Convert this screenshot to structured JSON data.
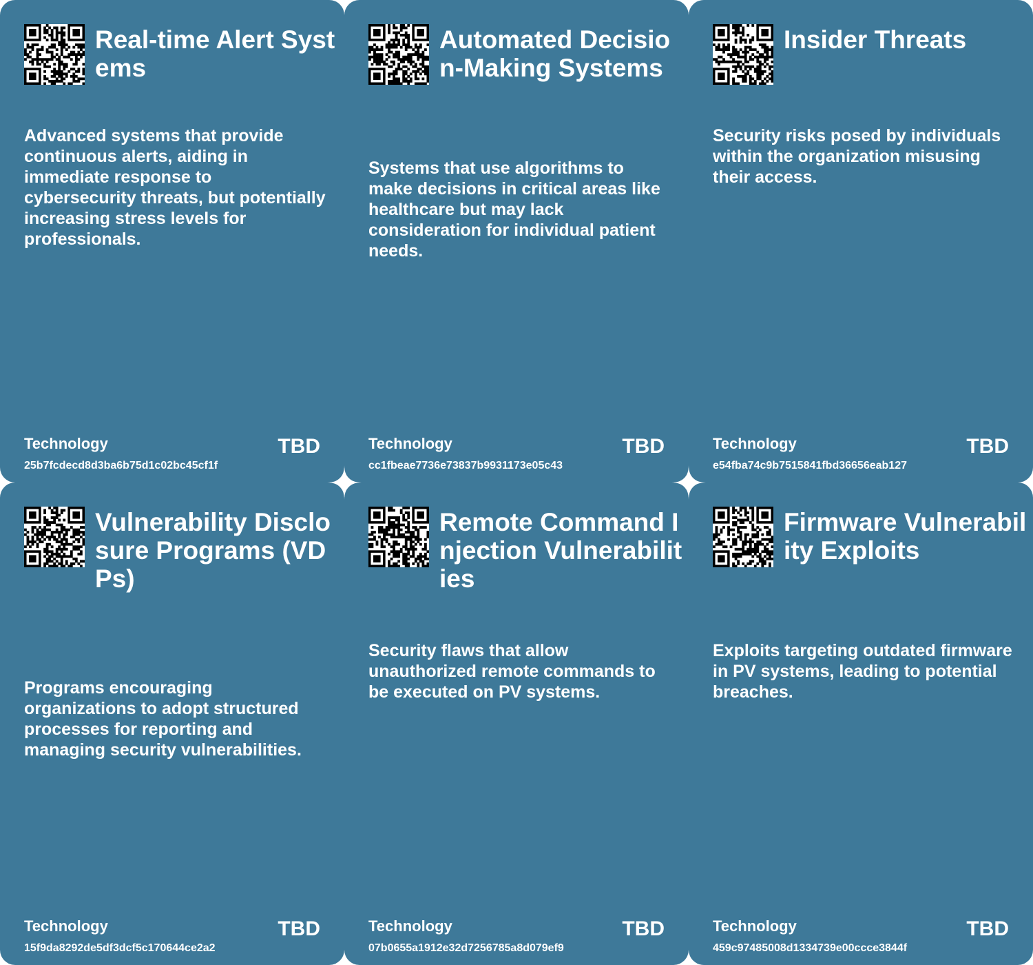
{
  "colors": {
    "card_background": "#3e7999",
    "text": "#ffffff",
    "page_background": "#ffffff"
  },
  "cards": [
    {
      "title": "Real-time Alert Systems",
      "description": "Advanced systems that provide continuous alerts, aiding in immediate response to cybersecurity threats, but potentially increasing stress levels for professionals.",
      "category": "Technology",
      "status": "TBD",
      "hash": "25b7fcdecd8d3ba6b75d1c02bc45cf1f",
      "icon": "qr-code-icon"
    },
    {
      "title": "Automated Decision-Making Systems",
      "description": "Systems that use algorithms to make decisions in critical areas like healthcare but may lack consideration for individual patient needs.",
      "category": "Technology",
      "status": "TBD",
      "hash": "cc1fbeae7736e73837b9931173e05c43",
      "icon": "qr-code-icon"
    },
    {
      "title": "Insider Threats",
      "description": "Security risks posed by individuals within the organization misusing their access.",
      "category": "Technology",
      "status": "TBD",
      "hash": "e54fba74c9b7515841fbd36656eab127",
      "icon": "qr-code-icon"
    },
    {
      "title": "Vulnerability Disclosure Programs (VDPs)",
      "description": "Programs encouraging organizations to adopt structured processes for reporting and managing security vulnerabilities.",
      "category": "Technology",
      "status": "TBD",
      "hash": "15f9da8292de5df3dcf5c170644ce2a2",
      "icon": "qr-code-icon"
    },
    {
      "title": "Remote Command Injection Vulnerabilities",
      "description": "Security flaws that allow unauthorized remote commands to be executed on PV systems.",
      "category": "Technology",
      "status": "TBD",
      "hash": "07b0655a1912e32d7256785a8d079ef9",
      "icon": "qr-code-icon"
    },
    {
      "title": "Firmware Vulnerability Exploits",
      "description": "Exploits targeting outdated firmware in PV systems, leading to potential breaches.",
      "category": "Technology",
      "status": "TBD",
      "hash": "459c97485008d1334739e00ccce3844f",
      "icon": "qr-code-icon"
    }
  ]
}
